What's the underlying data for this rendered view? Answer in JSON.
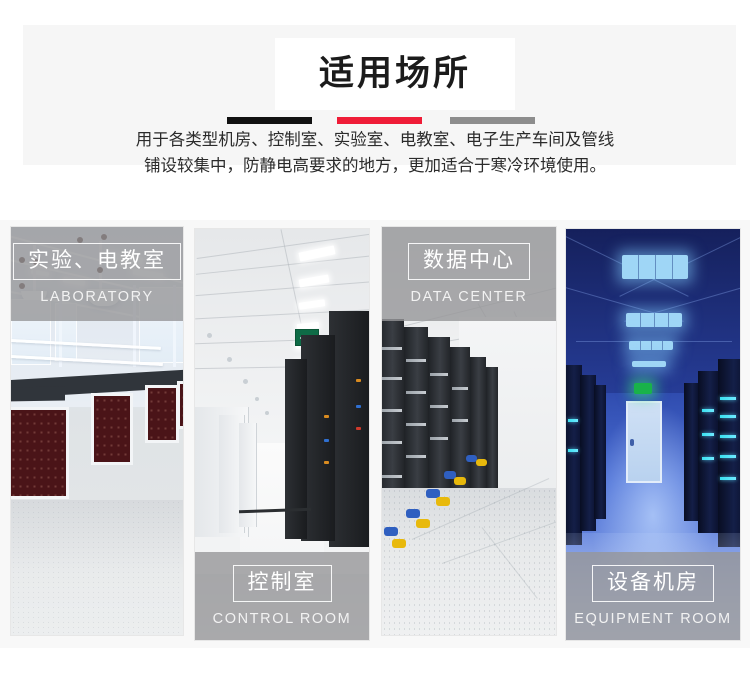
{
  "header": {
    "title": "适用场所",
    "rules": [
      {
        "name": "black",
        "color": "#111111"
      },
      {
        "name": "red",
        "color": "#ef1c37"
      },
      {
        "name": "gray",
        "color": "#8d8d8d"
      }
    ],
    "description_lines": [
      "用于各类型机房、控制室、实验室、电教室、电子生产车间及管线",
      "铺设较集中，防静电高要求的地方，更加适合于寒冷环境使用。"
    ]
  },
  "gallery": {
    "panels": [
      {
        "id": "laboratory",
        "caption_cn": "实验、电教室",
        "caption_en": "LABORATORY",
        "caption_position": "top"
      },
      {
        "id": "control-room",
        "caption_cn": "控制室",
        "caption_en": "CONTROL ROOM",
        "caption_position": "bottom"
      },
      {
        "id": "data-center",
        "caption_cn": "数据中心",
        "caption_en": "DATA CENTER",
        "caption_position": "top"
      },
      {
        "id": "equipment-room",
        "caption_cn": "设备机房",
        "caption_en": "EQUIPMENT ROOM",
        "caption_position": "bottom"
      }
    ]
  },
  "colors": {
    "page_background": "#ffffff",
    "band_background": "#f6f6f6",
    "gallery_background": "#f8f8f8",
    "title_plate": "#ffffff",
    "caption_overlay": "rgba(150,150,152,0.80)",
    "accent_red": "#ef1c37"
  }
}
